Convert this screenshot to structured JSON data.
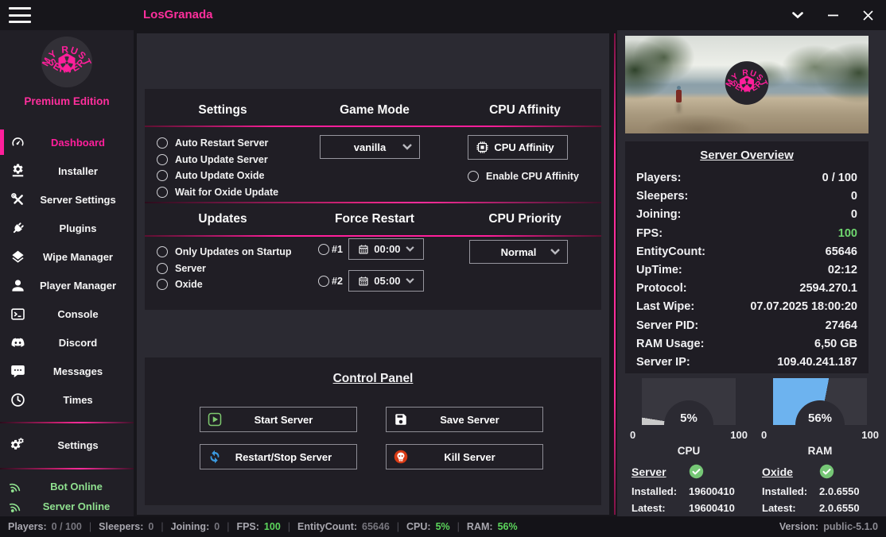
{
  "window": {
    "title": "LosGranada"
  },
  "sidebar": {
    "logo": {
      "arc_top": "MY RUST",
      "arc_bottom": "SERVER",
      "edition": "Premium Edition"
    },
    "items": [
      {
        "label": "Dashboard",
        "icon": "dashboard-icon",
        "active": true
      },
      {
        "label": "Installer",
        "icon": "installer-icon",
        "active": false
      },
      {
        "label": "Server Settings",
        "icon": "tools-icon",
        "active": false
      },
      {
        "label": "Plugins",
        "icon": "plug-icon",
        "active": false
      },
      {
        "label": "Wipe Manager",
        "icon": "layers-icon",
        "active": false
      },
      {
        "label": "Player Manager",
        "icon": "person-icon",
        "active": false
      },
      {
        "label": "Console",
        "icon": "terminal-icon",
        "active": false
      },
      {
        "label": "Discord",
        "icon": "discord-icon",
        "active": false
      },
      {
        "label": "Messages",
        "icon": "chat-icon",
        "active": false
      },
      {
        "label": "Times",
        "icon": "clock-icon",
        "active": false
      }
    ],
    "settings_label": "Settings",
    "status": [
      {
        "label": "Bot Online",
        "icon": "broadcast-icon"
      },
      {
        "label": "Server Online",
        "icon": "broadcast-icon"
      }
    ]
  },
  "panels": {
    "settings": {
      "title": "Settings",
      "options": [
        "Auto Restart Server",
        "Auto Update Server",
        "Auto Update Oxide",
        "Wait for Oxide Update"
      ]
    },
    "game_mode": {
      "title": "Game Mode",
      "selected": "vanilla"
    },
    "cpu_affinity": {
      "title": "CPU Affinity",
      "button": "CPU Affinity",
      "enable": "Enable CPU Affinity"
    },
    "updates": {
      "title": "Updates",
      "options": [
        "Only Updates on Startup",
        "Server",
        "Oxide"
      ]
    },
    "force_restart": {
      "title": "Force Restart",
      "slots": [
        {
          "num": "#1",
          "time": "00:00"
        },
        {
          "num": "#2",
          "time": "05:00"
        }
      ]
    },
    "cpu_priority": {
      "title": "CPU Priority",
      "selected": "Normal"
    },
    "control_panel": {
      "title": "Control Panel",
      "buttons": [
        {
          "label": "Start Server",
          "icon": "play-icon"
        },
        {
          "label": "Save Server",
          "icon": "save-icon"
        },
        {
          "label": "Restart/Stop Server",
          "icon": "restart-icon"
        },
        {
          "label": "Kill Server",
          "icon": "skull-icon"
        }
      ]
    }
  },
  "overview": {
    "title": "Server Overview",
    "rows": [
      {
        "label": "Players:",
        "value": "0 / 100"
      },
      {
        "label": "Sleepers:",
        "value": "0"
      },
      {
        "label": "Joining:",
        "value": "0"
      },
      {
        "label": "FPS:",
        "value": "100",
        "color": "green"
      },
      {
        "label": "EntityCount:",
        "value": "65646"
      },
      {
        "label": "UpTime:",
        "value": "02:12"
      },
      {
        "label": "Protocol:",
        "value": "2594.270.1"
      },
      {
        "label": "Last Wipe:",
        "value": "07.07.2025 18:00:20"
      },
      {
        "label": "Server PID:",
        "value": "27464"
      },
      {
        "label": "RAM Usage:",
        "value": "6,50 GB"
      },
      {
        "label": "Server IP:",
        "value": "109.40.241.187"
      }
    ]
  },
  "gauges": [
    {
      "name": "CPU",
      "display": "5%",
      "value": 5,
      "min": "0",
      "max": "100",
      "color": "#c9c9c9"
    },
    {
      "name": "RAM",
      "display": "56%",
      "value": 56,
      "min": "0",
      "max": "100",
      "color": "#6db3ef"
    }
  ],
  "versions": [
    {
      "title": "Server",
      "installed_label": "Installed:",
      "installed": "19600410",
      "latest_label": "Latest:",
      "latest": "19600410",
      "status_icon": "check-icon"
    },
    {
      "title": "Oxide",
      "installed_label": "Installed:",
      "installed": "2.0.6550",
      "latest_label": "Latest:",
      "latest": "2.0.6550",
      "status_icon": "check-icon"
    }
  ],
  "statusbar": {
    "items": [
      {
        "label": "Players:",
        "value": "0 / 100",
        "green": false
      },
      {
        "label": "Sleepers:",
        "value": "0",
        "green": false
      },
      {
        "label": "Joining:",
        "value": "0",
        "green": false
      },
      {
        "label": "FPS:",
        "value": "100",
        "green": true
      },
      {
        "label": "EntityCount:",
        "value": "65646",
        "green": false
      },
      {
        "label": "CPU:",
        "value": "5%",
        "green": true
      },
      {
        "label": "RAM:",
        "value": "56%",
        "green": true
      }
    ],
    "version_label": "Version:",
    "version_value": "public-5.1.0"
  },
  "colors": {
    "accent": "#ff2d9c",
    "green": "#6fd66f",
    "blue": "#6db3ef",
    "red": "#d83a14"
  }
}
